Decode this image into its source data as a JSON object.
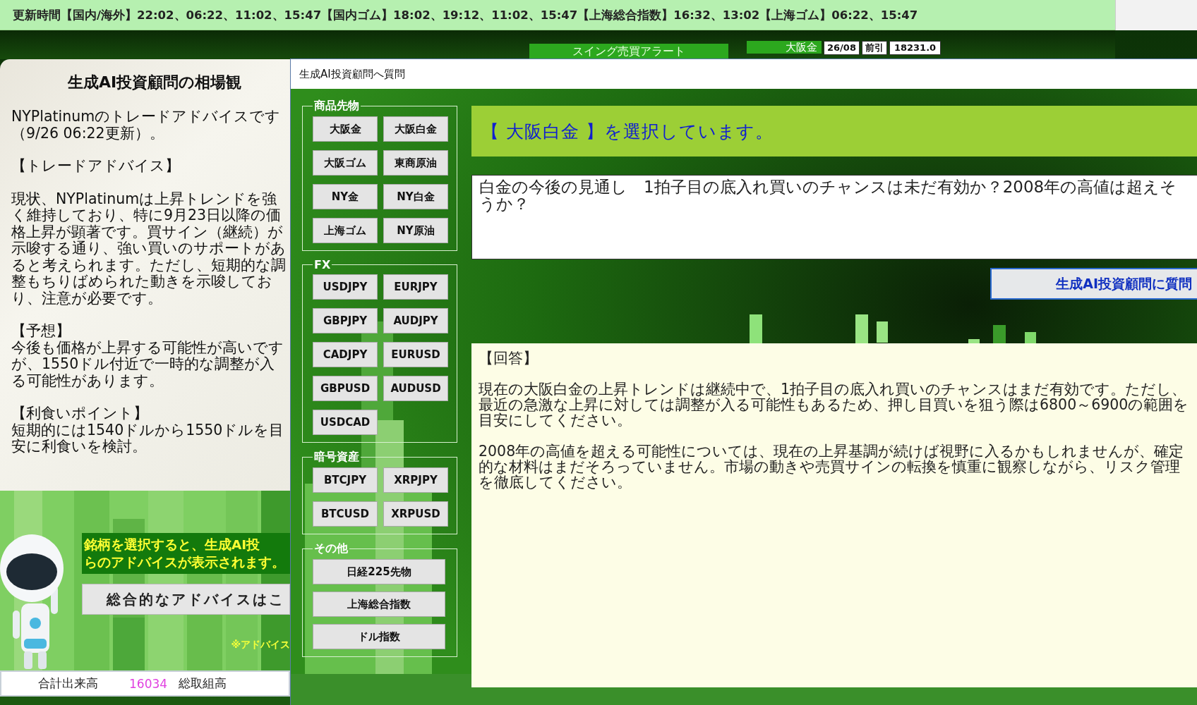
{
  "update_bar": {
    "text": "更新時間【国内/海外】22:02、06:22、11:02、15:47【国内ゴム】18:02、19:12、11:02、15:47【上海総合指数】16:32、13:02【上海ゴム】06:22、15:47"
  },
  "back_header": {
    "alert_label": "スイング売買アラート",
    "ticker": {
      "name": "大阪金",
      "month": "26/08",
      "session": "前引",
      "price": "18231.0"
    }
  },
  "advice_panel": {
    "title": "生成AI投資顧問の相場観",
    "blocks": [
      {
        "text": "NYPlatinumのトレードアドバイスです（9/26 06:22更新）。"
      },
      {
        "heading": "【トレードアドバイス】"
      },
      {
        "text": "現状、NYPlatinumは上昇トレンドを強く維持しており、特に9月23日以降の価格上昇が顕著です。買サイン（継続）が示唆する通り、強い買いのサポートがあると考えられます。ただし、短期的な調整もちりばめられた動きを示唆しており、注意が必要です。"
      },
      {
        "heading": "【予想】",
        "text": "今後も価格が上昇する可能性が高いですが、1550ドル付近で一時的な調整が入る可能性があります。"
      },
      {
        "heading": "【利食いポイント】",
        "text": "短期的には1540ドルから1550ドルを目安に利食いを検討。"
      }
    ]
  },
  "promo": {
    "hint_lines": [
      "銘柄を選択すると、生成AI投",
      "らのアドバイスが表示されます。"
    ],
    "button": "総合的なアドバイスはこ",
    "note": "※アドバイス"
  },
  "volume_row": {
    "label": "合計出来高",
    "value": "16034",
    "label_2": "総取組高"
  },
  "dialog": {
    "title": "生成AI投資顧問へ質問",
    "groups": [
      {
        "label": "商品先物",
        "kind": "pairs",
        "buttons": [
          "大阪金",
          "大阪白金",
          "大阪ゴム",
          "東商原油",
          "NY金",
          "NY白金",
          "上海ゴム",
          "NY原油"
        ]
      },
      {
        "label": "FX",
        "kind": "pairs",
        "buttons": [
          "USDJPY",
          "EURJPY",
          "GBPJPY",
          "AUDJPY",
          "CADJPY",
          "EURUSD",
          "GBPUSD",
          "AUDUSD",
          "USDCAD"
        ]
      },
      {
        "label": "暗号資産",
        "kind": "pairs",
        "buttons": [
          "BTCJPY",
          "XRPJPY",
          "BTCUSD",
          "XRPUSD"
        ]
      },
      {
        "label": "その他",
        "kind": "single",
        "buttons": [
          "日経225先物",
          "上海総合指数",
          "ドル指数"
        ]
      }
    ],
    "selection": "【 大阪白金 】を選択しています。",
    "question": "白金の今後の見通し　1拍子目の底入れ買いのチャンスは未だ有効か？2008年の高値は超えそうか？",
    "ask_button": "生成AI投資顧問に質問",
    "answer": [
      "【回答】",
      "現在の大阪白金の上昇トレンドは継続中で、1拍子目の底入れ買いのチャンスはまだ有効です。ただし、最近の急激な上昇に対しては調整が入る可能性もあるため、押し目買いを狙う際は6800～6900の範囲を目安にしてください。",
      "2008年の高値を超える可能性については、現在の上昇基調が続けば視野に入るかもしれませんが、確定的な材料はまだそろっていません。市場の動きや売買サインの転換を慎重に観察しながら、リスク管理を徹底してください。"
    ]
  }
}
